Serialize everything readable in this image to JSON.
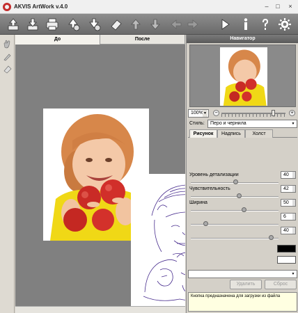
{
  "window": {
    "title": "AKVIS ArtWork v.4.0",
    "minimize_glyph": "–",
    "maximize_glyph": "□",
    "close_glyph": "×"
  },
  "toolbar": {
    "left_icons": [
      "open-icon",
      "save-icon",
      "print-icon",
      "publish-icon",
      "share-icon",
      "eraser-icon",
      "batch-up-icon",
      "batch-down-icon"
    ],
    "nav_icons": [
      "undo-arrow-icon",
      "redo-arrow-icon"
    ],
    "right_icons": [
      "run-icon",
      "info-icon",
      "help-icon",
      "settings-icon"
    ],
    "help_glyph": "?",
    "info_glyph": "i",
    "settings_glyph": "⚙"
  },
  "left_tools": [
    "hand-tool-icon",
    "zoom-tool-icon",
    "eraser-tool-icon"
  ],
  "canvas": {
    "tab_before": "До",
    "tab_after": "После"
  },
  "navigator": {
    "header": "Навигатор",
    "zoom_value": "100%",
    "zoom_level": 0.82,
    "zoom_minus": "−",
    "zoom_plus": "+"
  },
  "style": {
    "label": "Стиль:",
    "value": "Перо и чернила"
  },
  "param_tabs": [
    "Рисунок",
    "Надпись",
    "Холст"
  ],
  "params": [
    {
      "label": "Уровень детализации",
      "value": "40",
      "level": 0.5
    },
    {
      "label": "Чувствительность",
      "value": "42",
      "level": 0.54
    },
    {
      "label": "Ширина",
      "value": "50",
      "level": 0.6
    },
    {
      "label": "",
      "value": "6",
      "level": 0.15
    },
    {
      "label": "",
      "value": "40",
      "level": 0.92
    }
  ],
  "colors": {
    "swatch_1": "#000000",
    "swatch_2": "#ffffff",
    "toolbar_bg": "#7a7a7a",
    "canvas_bg": "#808080"
  },
  "presets": {
    "delete_label": "Удалить",
    "reset_label": "Сброс"
  },
  "hint": "Кнопка предназначена для загрузки из файла"
}
